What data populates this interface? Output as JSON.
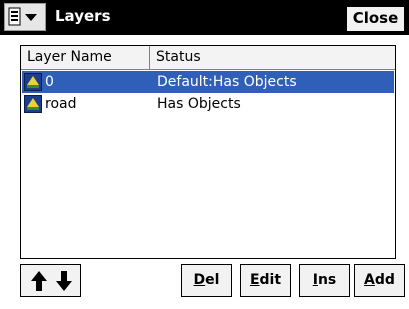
{
  "window": {
    "title": "Layers",
    "close_label": "Close"
  },
  "columns": [
    "Layer Name",
    "Status"
  ],
  "rows": [
    {
      "name": "0",
      "status": "Default:Has Objects",
      "selected": true
    },
    {
      "name": "road",
      "status": "Has Objects",
      "selected": false
    }
  ],
  "buttons": {
    "del": {
      "u": "D",
      "rest": "el"
    },
    "edit": {
      "u": "E",
      "rest": "dit"
    },
    "ins": {
      "u": "I",
      "rest": "ns"
    },
    "add": {
      "u": "A",
      "rest": "dd"
    }
  },
  "colors": {
    "titlebar": "#000000",
    "selection": "#2f5fb8"
  },
  "icons": [
    "layers-menu-icon",
    "layer-icon",
    "arrow-up-icon",
    "arrow-down-icon"
  ]
}
